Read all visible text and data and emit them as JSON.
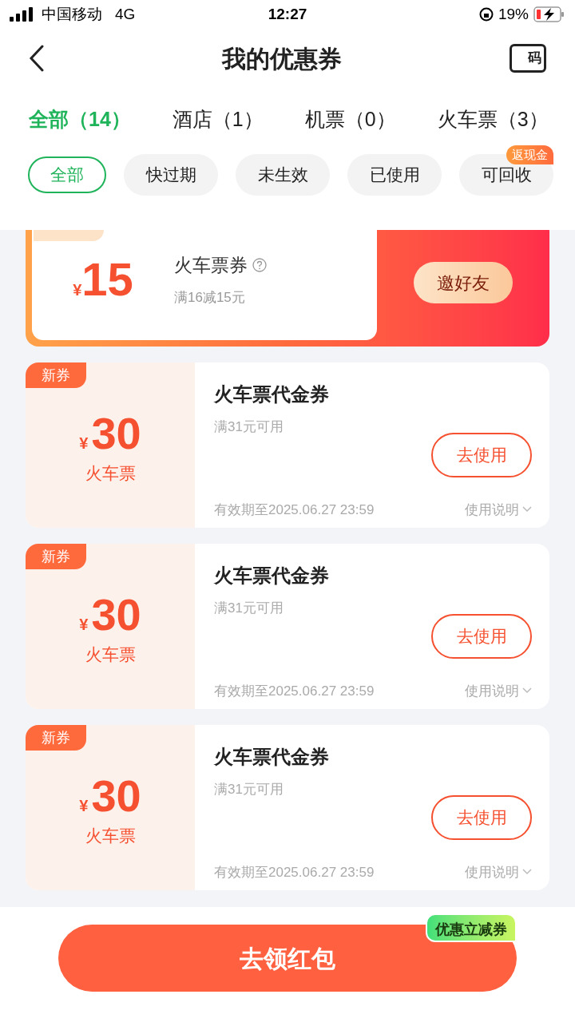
{
  "status_bar": {
    "carrier": "中国移动",
    "network": "4G",
    "time": "12:27",
    "battery": "19%"
  },
  "header": {
    "title": "我的优惠券",
    "code_icon_text": "码"
  },
  "tabs": [
    {
      "label": "全部（14）",
      "selected": true
    },
    {
      "label": "酒店（1）",
      "selected": false
    },
    {
      "label": "机票（0）",
      "selected": false
    },
    {
      "label": "火车票（3）",
      "selected": false
    }
  ],
  "filters": [
    {
      "label": "全部",
      "selected": true
    },
    {
      "label": "快过期",
      "selected": false
    },
    {
      "label": "未生效",
      "selected": false
    },
    {
      "label": "已使用",
      "selected": false
    },
    {
      "label": "可回收",
      "selected": false,
      "badge": "返现金"
    }
  ],
  "promo": {
    "currency": "¥",
    "amount": "15",
    "name": "火车票券",
    "rule": "满16减15元",
    "button": "邀好友"
  },
  "coupons": [
    {
      "tag": "新券",
      "currency": "¥",
      "amount": "30",
      "category": "火车票",
      "title": "火车票代金券",
      "rule": "满31元可用",
      "button": "去使用",
      "validity": "有效期至2025.06.27 23:59",
      "help": "使用说明"
    },
    {
      "tag": "新券",
      "currency": "¥",
      "amount": "30",
      "category": "火车票",
      "title": "火车票代金券",
      "rule": "满31元可用",
      "button": "去使用",
      "validity": "有效期至2025.06.27 23:59",
      "help": "使用说明"
    },
    {
      "tag": "新券",
      "currency": "¥",
      "amount": "30",
      "category": "火车票",
      "title": "火车票代金券",
      "rule": "满31元可用",
      "button": "去使用",
      "validity": "有效期至2025.06.27 23:59",
      "help": "使用说明"
    }
  ],
  "bottom": {
    "button": "去领红包",
    "badge": "优惠立减券"
  }
}
